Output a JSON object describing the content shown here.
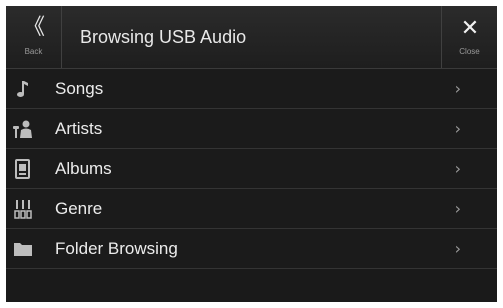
{
  "header": {
    "title": "Browsing USB Audio",
    "back": {
      "icon": "double-chevron-left-icon",
      "glyph": "《",
      "label": "Back"
    },
    "close": {
      "icon": "close-icon",
      "glyph": "✕",
      "label": "Close"
    }
  },
  "list": {
    "items": [
      {
        "label": "Songs",
        "icon": "music-note-icon"
      },
      {
        "label": "Artists",
        "icon": "artist-icon"
      },
      {
        "label": "Albums",
        "icon": "album-icon"
      },
      {
        "label": "Genre",
        "icon": "genre-icon"
      },
      {
        "label": "Folder Browsing",
        "icon": "folder-icon"
      }
    ],
    "chevron_glyph": "›"
  },
  "colors": {
    "background": "#1a1a1a",
    "header": "#262626",
    "text": "#ececec",
    "icon": "#bdbdbd"
  }
}
